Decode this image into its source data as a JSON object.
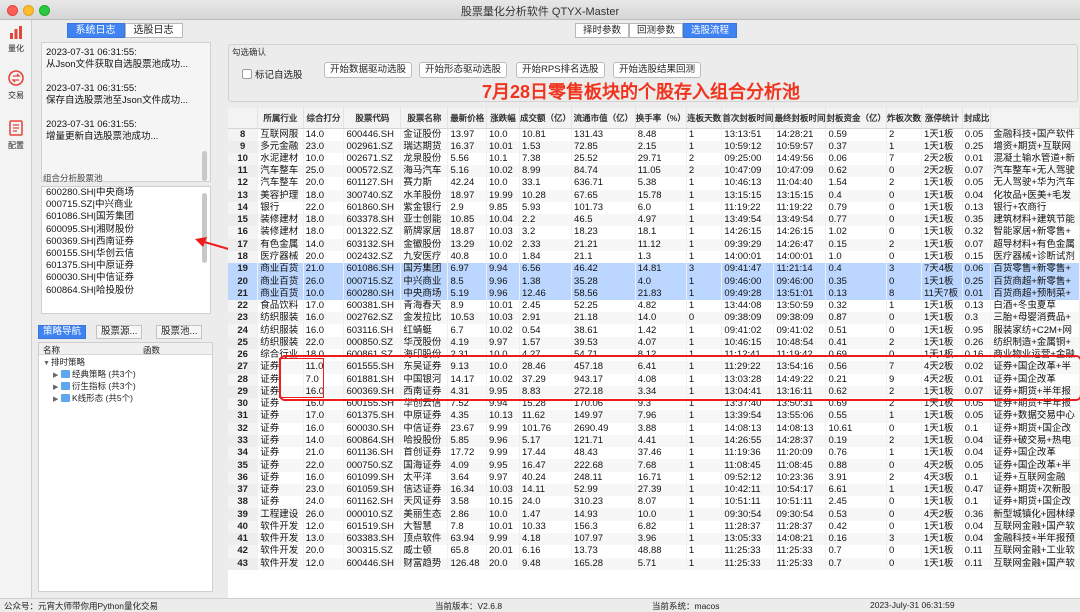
{
  "window": {
    "title": "股票量化分析软件 QTYX-Master"
  },
  "iconbar": [
    {
      "icon": "bar-chart-icon",
      "label": "量化"
    },
    {
      "icon": "exchange-icon",
      "label": "交易"
    },
    {
      "icon": "document-icon",
      "label": "配置"
    }
  ],
  "left": {
    "tabs": [
      "系统日志",
      "选股日志"
    ],
    "active_tab": "系统日志",
    "log": [
      "2023-07-31 06:31:55:\n从Json文件获取自选股票池成功...",
      "2023-07-31 06:31:55:\n保存自选股票池至Json文件成功...",
      "2023-07-31 06:31:55:\n增量更新自选股票池成功..."
    ],
    "pool_label": "组合分析股票池",
    "pool": [
      "600280.SH|中央商场",
      "000715.SZ|中兴商业",
      "601086.SH|国芳集团",
      "600095.SH|湘财股份",
      "600369.SH|西南证券",
      "600155.SH|华创云信",
      "601375.SH|中原证券",
      "600030.SH|中信证券",
      "600864.SH|哈投股份"
    ],
    "nav_tabs": [
      "策略导航",
      "股票源...",
      "股票池..."
    ],
    "tree_headers": [
      "名称",
      "函数"
    ],
    "tree": {
      "root": "排时策略",
      "children": [
        "经典策略 (共3个)",
        "衍生指标 (共3个)",
        "K线形态 (共5个)"
      ]
    }
  },
  "right": {
    "top_tabs": [
      "择时参数",
      "回测参数",
      "选股流程"
    ],
    "active_top_tab": "选股流程",
    "group_title": "勾选确认",
    "checkbox_label": "标记自选股",
    "buttons": [
      "开始数据驱动选股",
      "开始形态驱动选股",
      "开始RPS排名选股",
      "开始选股结果回测"
    ],
    "banner": "7月28日零售板块的个股存入组合分析池",
    "columns": [
      "",
      "所属行业",
      "综合打分",
      "股票代码",
      "股票名称",
      "最新价格",
      "涨跌幅",
      "成交额（亿）",
      "流通市值（亿）",
      "换手率（%）",
      "连板天数",
      "首次封板时间",
      "最终封板时间",
      "封板资金（亿）",
      "炸板次数",
      "涨停统计",
      "封成比",
      ""
    ],
    "rows": [
      [
        "8",
        "互联网服",
        "14.0",
        "600446.SH",
        "金证股份",
        "13.97",
        "10.0",
        "10.81",
        "131.43",
        "8.48",
        "1",
        "13:13:51",
        "14:28:21",
        "0.59",
        "2",
        "1天1板",
        "0.05",
        "金融科技+国产软件"
      ],
      [
        "9",
        "多元金融",
        "23.0",
        "002961.SZ",
        "瑞达期货",
        "16.37",
        "10.01",
        "1.53",
        "72.85",
        "2.15",
        "1",
        "10:59:12",
        "10:59:57",
        "0.37",
        "1",
        "1天1板",
        "0.25",
        "增资+期货+互联网"
      ],
      [
        "10",
        "水泥建材",
        "10.0",
        "002671.SZ",
        "龙泉股份",
        "5.56",
        "10.1",
        "7.38",
        "25.52",
        "29.71",
        "2",
        "09:25:00",
        "14:49:56",
        "0.06",
        "7",
        "2天2板",
        "0.01",
        "混凝土输水管道+新"
      ],
      [
        "11",
        "汽车整车",
        "25.0",
        "000572.SZ",
        "海马汽车",
        "5.16",
        "10.02",
        "8.99",
        "84.74",
        "11.05",
        "2",
        "10:47:09",
        "10:47:09",
        "0.62",
        "0",
        "2天2板",
        "0.07",
        "汽车整车+无人驾驶"
      ],
      [
        "12",
        "汽车整车",
        "20.0",
        "601127.SH",
        "赛力斯",
        "42.24",
        "10.0",
        "33.1",
        "636.71",
        "5.38",
        "1",
        "10:46:13",
        "11:04:40",
        "1.54",
        "2",
        "1天1板",
        "0.05",
        "无人驾驶+华为汽车"
      ],
      [
        "13",
        "美容护理",
        "18.0",
        "300740.SZ",
        "水羊股份",
        "18.97",
        "19.99",
        "10.28",
        "67.65",
        "15.78",
        "1",
        "13:15:15",
        "13:15:15",
        "0.4",
        "0",
        "1天1板",
        "0.04",
        "化妆品+医美+毛发"
      ],
      [
        "14",
        "银行",
        "22.0",
        "601860.SH",
        "紫金银行",
        "2.9",
        "9.85",
        "5.93",
        "101.73",
        "6.0",
        "1",
        "11:19:22",
        "11:19:22",
        "0.79",
        "0",
        "1天1板",
        "0.13",
        "银行+农商行"
      ],
      [
        "15",
        "装修建材",
        "18.0",
        "603378.SH",
        "亚士创能",
        "10.85",
        "10.04",
        "2.2",
        "46.5",
        "4.97",
        "1",
        "13:49:54",
        "13:49:54",
        "0.77",
        "0",
        "1天1板",
        "0.35",
        "建筑材料+建筑节能"
      ],
      [
        "16",
        "装修建材",
        "18.0",
        "001322.SZ",
        "箭牌家居",
        "18.87",
        "10.03",
        "3.2",
        "18.23",
        "18.1",
        "1",
        "14:26:15",
        "14:26:15",
        "1.02",
        "0",
        "1天1板",
        "0.32",
        "智能家居+新零售+"
      ],
      [
        "17",
        "有色金属",
        "14.0",
        "603132.SH",
        "金徽股份",
        "13.29",
        "10.02",
        "2.33",
        "21.21",
        "11.12",
        "1",
        "09:39:29",
        "14:26:47",
        "0.15",
        "2",
        "1天1板",
        "0.07",
        "超导材料+有色金属"
      ],
      [
        "18",
        "医疗器械",
        "20.0",
        "002432.SZ",
        "九安医疗",
        "40.8",
        "10.0",
        "1.84",
        "21.1",
        "1.3",
        "1",
        "14:00:01",
        "14:00:01",
        "1.0",
        "0",
        "1天1板",
        "0.15",
        "医疗器械+诊断试剂"
      ],
      [
        "19",
        "商业百货",
        "21.0",
        "601086.SH",
        "国芳集团",
        "6.97",
        "9.94",
        "6.56",
        "46.42",
        "14.81",
        "3",
        "09:41:47",
        "11:21:14",
        "0.4",
        "3",
        "7天4板",
        "0.06",
        "百货零售+新零售+"
      ],
      [
        "20",
        "商业百货",
        "26.0",
        "000715.SZ",
        "中兴商业",
        "8.5",
        "9.96",
        "1.38",
        "35.28",
        "4.0",
        "1",
        "09:46:00",
        "09:46:00",
        "0.35",
        "0",
        "1天1板",
        "0.25",
        "百货商超+新零售+"
      ],
      [
        "21",
        "商业百货",
        "10.0",
        "600280.SH",
        "中央商场",
        "5.19",
        "9.96",
        "12.46",
        "58.56",
        "21.83",
        "1",
        "09:49:28",
        "13:51:01",
        "0.13",
        "8",
        "11天7板",
        "0.01",
        "百货商超+预制菜+"
      ],
      [
        "22",
        "食品饮料",
        "17.0",
        "600381.SH",
        "青海春天",
        "8.9",
        "10.01",
        "2.45",
        "52.25",
        "4.82",
        "1",
        "13:44:08",
        "13:50:59",
        "0.32",
        "1",
        "1天1板",
        "0.13",
        "白酒+冬虫夏草"
      ],
      [
        "23",
        "纺织服装",
        "16.0",
        "002762.SZ",
        "金发拉比",
        "10.53",
        "10.03",
        "2.91",
        "21.18",
        "14.0",
        "0",
        "09:38:09",
        "09:38:09",
        "0.87",
        "0",
        "1天1板",
        "0.3",
        "三胎+母婴消费品+"
      ],
      [
        "24",
        "纺织服装",
        "16.0",
        "603116.SH",
        "红蜻蜓",
        "6.7",
        "10.02",
        "0.54",
        "38.61",
        "1.42",
        "1",
        "09:41:02",
        "09:41:02",
        "0.51",
        "0",
        "1天1板",
        "0.95",
        "服装家纺+C2M+网"
      ],
      [
        "25",
        "纺织服装",
        "22.0",
        "000850.SZ",
        "华茂股份",
        "4.19",
        "9.97",
        "1.57",
        "39.53",
        "4.07",
        "1",
        "10:46:15",
        "10:48:54",
        "0.41",
        "2",
        "1天1板",
        "0.26",
        "纺织制造+金属铜+"
      ],
      [
        "26",
        "综合行业",
        "18.0",
        "600861.SZ",
        "海印股份",
        "2.31",
        "10.0",
        "4.27",
        "54.71",
        "8.12",
        "1",
        "11:12:41",
        "11:19:42",
        "0.69",
        "0",
        "1天1板",
        "0.16",
        "商业物业运营+金融"
      ],
      [
        "27",
        "证券",
        "11.0",
        "601555.SH",
        "东吴证券",
        "9.13",
        "10.0",
        "28.46",
        "457.18",
        "6.41",
        "1",
        "11:29:22",
        "13:54:16",
        "0.56",
        "7",
        "4天2板",
        "0.02",
        "证券+国企改革+半"
      ],
      [
        "28",
        "证券",
        "7.0",
        "601881.SH",
        "中国银河",
        "14.17",
        "10.02",
        "37.29",
        "943.17",
        "4.08",
        "1",
        "13:03:28",
        "14:49:22",
        "0.21",
        "9",
        "4天2板",
        "0.01",
        "证券+国企改革"
      ],
      [
        "29",
        "证券",
        "16.0",
        "600369.SH",
        "西南证券",
        "4.31",
        "9.95",
        "8.83",
        "272.18",
        "3.34",
        "1",
        "13:04:41",
        "13:16:11",
        "0.62",
        "2",
        "1天1板",
        "0.07",
        "证券+期货+半年报"
      ],
      [
        "30",
        "证券",
        "16.0",
        "600155.SH",
        "华创云信",
        "7.52",
        "9.94",
        "15.28",
        "170.06",
        "9.3",
        "1",
        "13:37:40",
        "13:50:31",
        "0.69",
        "2",
        "1天1板",
        "0.05",
        "证券+期货+半年报"
      ],
      [
        "31",
        "证券",
        "17.0",
        "601375.SH",
        "中原证券",
        "4.35",
        "10.13",
        "11.62",
        "149.97",
        "7.96",
        "1",
        "13:39:54",
        "13:55:06",
        "0.55",
        "1",
        "1天1板",
        "0.05",
        "证券+数据交易中心"
      ],
      [
        "32",
        "证券",
        "16.0",
        "600030.SH",
        "中信证券",
        "23.67",
        "9.99",
        "101.76",
        "2690.49",
        "3.88",
        "1",
        "14:08:13",
        "14:08:13",
        "10.61",
        "0",
        "1天1板",
        "0.1",
        "证券+期货+国企改"
      ],
      [
        "33",
        "证券",
        "14.0",
        "600864.SH",
        "哈投股份",
        "5.85",
        "9.96",
        "5.17",
        "121.71",
        "4.41",
        "1",
        "14:26:55",
        "14:28:37",
        "0.19",
        "2",
        "1天1板",
        "0.04",
        "证券+破交易+热电"
      ],
      [
        "34",
        "证券",
        "21.0",
        "601136.SH",
        "首创证券",
        "17.72",
        "9.99",
        "17.44",
        "48.43",
        "37.46",
        "1",
        "11:19:36",
        "11:20:09",
        "0.76",
        "1",
        "1天1板",
        "0.04",
        "证券+国企改革"
      ],
      [
        "35",
        "证券",
        "22.0",
        "000750.SZ",
        "国海证券",
        "4.09",
        "9.95",
        "16.47",
        "222.68",
        "7.68",
        "1",
        "11:08:45",
        "11:08:45",
        "0.88",
        "0",
        "4天2板",
        "0.05",
        "证券+国企改革+半"
      ],
      [
        "36",
        "证券",
        "16.0",
        "601099.SH",
        "太平洋",
        "3.64",
        "9.97",
        "40.24",
        "248.11",
        "16.71",
        "1",
        "09:52:12",
        "10:23:36",
        "3.91",
        "2",
        "4天3板",
        "0.1",
        "证券+互联网金融"
      ],
      [
        "37",
        "证券",
        "23.0",
        "601059.SH",
        "信达证券",
        "16.34",
        "10.03",
        "14.11",
        "52.99",
        "27.39",
        "1",
        "10:42:11",
        "10:54:17",
        "6.61",
        "1",
        "1天1板",
        "0.47",
        "证券+期货+次新股"
      ],
      [
        "38",
        "证券",
        "24.0",
        "601162.SH",
        "天风证券",
        "3.58",
        "10.15",
        "24.0",
        "310.23",
        "8.07",
        "1",
        "10:51:11",
        "10:51:11",
        "2.45",
        "0",
        "1天1板",
        "0.1",
        "证券+期货+国企改"
      ],
      [
        "39",
        "工程建设",
        "26.0",
        "000010.SZ",
        "美丽生态",
        "2.86",
        "10.0",
        "1.47",
        "14.93",
        "10.0",
        "1",
        "09:30:54",
        "09:30:54",
        "0.53",
        "0",
        "4天2板",
        "0.36",
        "新型城镇化+园林绿"
      ],
      [
        "40",
        "软件开发",
        "12.0",
        "601519.SH",
        "大智慧",
        "7.8",
        "10.01",
        "10.33",
        "156.3",
        "6.82",
        "1",
        "11:28:37",
        "11:28:37",
        "0.42",
        "0",
        "1天1板",
        "0.04",
        "互联网金融+国产软"
      ],
      [
        "41",
        "软件开发",
        "13.0",
        "603383.SH",
        "顶点软件",
        "63.94",
        "9.99",
        "4.18",
        "107.97",
        "3.96",
        "1",
        "13:05:33",
        "14:08:21",
        "0.16",
        "3",
        "1天1板",
        "0.04",
        "金融科技+半年报预"
      ],
      [
        "42",
        "软件开发",
        "20.0",
        "300315.SZ",
        "威士顿",
        "65.8",
        "20.01",
        "6.16",
        "13.73",
        "48.88",
        "1",
        "11:25:33",
        "11:25:33",
        "0.7",
        "0",
        "1天1板",
        "0.11",
        "互联网金融+工业软"
      ],
      [
        "43",
        "软件开发",
        "12.0",
        "600446.SH",
        "财富趋势",
        "126.48",
        "20.0",
        "9.48",
        "165.28",
        "5.71",
        "1",
        "11:25:33",
        "11:25:33",
        "0.7",
        "0",
        "1天1板",
        "0.11",
        "互联网金融+国产软"
      ]
    ]
  },
  "status": {
    "left": "公众号：元宵大师带你用Python量化交易",
    "version": "当前版本：V2.6.8",
    "system": "当前系统：macos",
    "datetime": "2023-July-31 06:31:59"
  },
  "colors": {
    "accent": "#3f82f2",
    "highlight": "#bcd7ff",
    "banner": "#f0341e",
    "annotation": "#ee1c1c"
  }
}
